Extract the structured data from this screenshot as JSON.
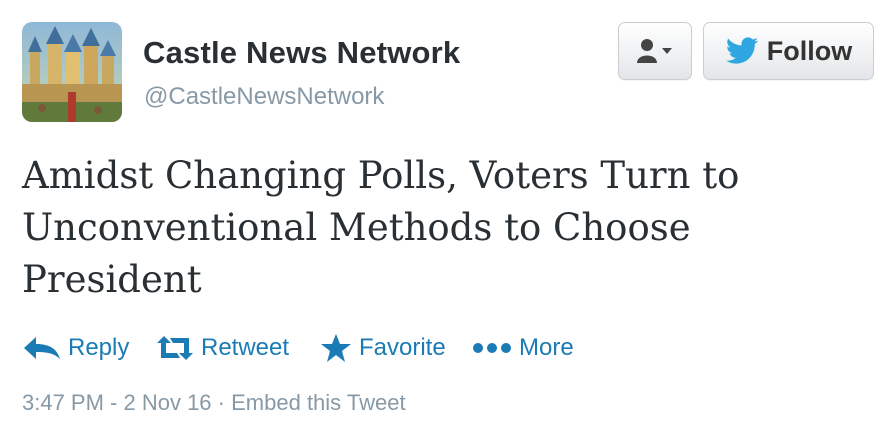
{
  "account": {
    "display_name": "Castle News Network",
    "handle": "@CastleNewsNetwork"
  },
  "buttons": {
    "user_dropdown_icon": "user-dropdown-icon",
    "follow_label": "Follow"
  },
  "tweet": {
    "text": "Amidst Changing Polls, Voters Turn to Unconventional Methods to Choose President"
  },
  "actions": [
    {
      "label": "Reply",
      "icon": "reply-arrow-icon"
    },
    {
      "label": "Retweet",
      "icon": "retweet-icon"
    },
    {
      "label": "Favorite",
      "icon": "star-icon"
    },
    {
      "label": "More",
      "icon": "more-dots-icon"
    }
  ],
  "meta": {
    "timestamp": "3:47 PM - 2 Nov 16",
    "separator": "·",
    "embed_label": "Embed this Tweet"
  },
  "colors": {
    "link_blue": "#1b7bb5",
    "twitter_bird": "#2ea7e0",
    "muted_gray": "#8899a6",
    "text_dark": "#292f33"
  }
}
